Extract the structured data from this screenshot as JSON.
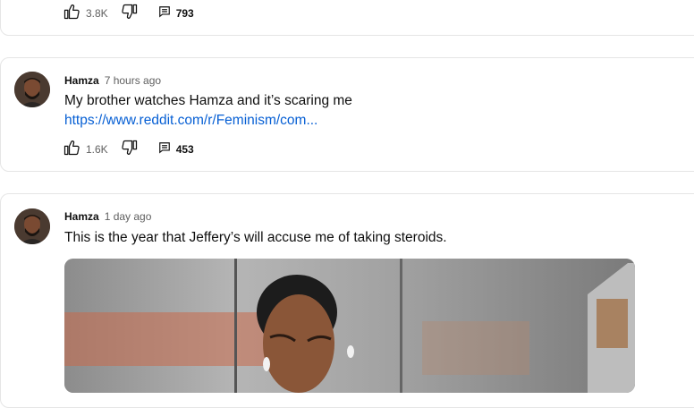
{
  "comments": [
    {
      "likes": "3.8K",
      "replies": "793"
    },
    {
      "author": "Hamza",
      "time": "7 hours ago",
      "text": "My brother watches Hamza and it’s scaring me",
      "link": "https://www.reddit.com/r/Feminism/com...",
      "likes": "1.6K",
      "replies": "453"
    },
    {
      "author": "Hamza",
      "time": "1 day ago",
      "text": "This is the year that Jeffery’s will accuse me of taking steroids."
    }
  ],
  "colors": {
    "link": "#065fd4",
    "meta": "#606060",
    "border": "#e5e5e5"
  },
  "icons": [
    "thumbs-up-icon",
    "thumbs-down-icon",
    "comment-icon"
  ]
}
